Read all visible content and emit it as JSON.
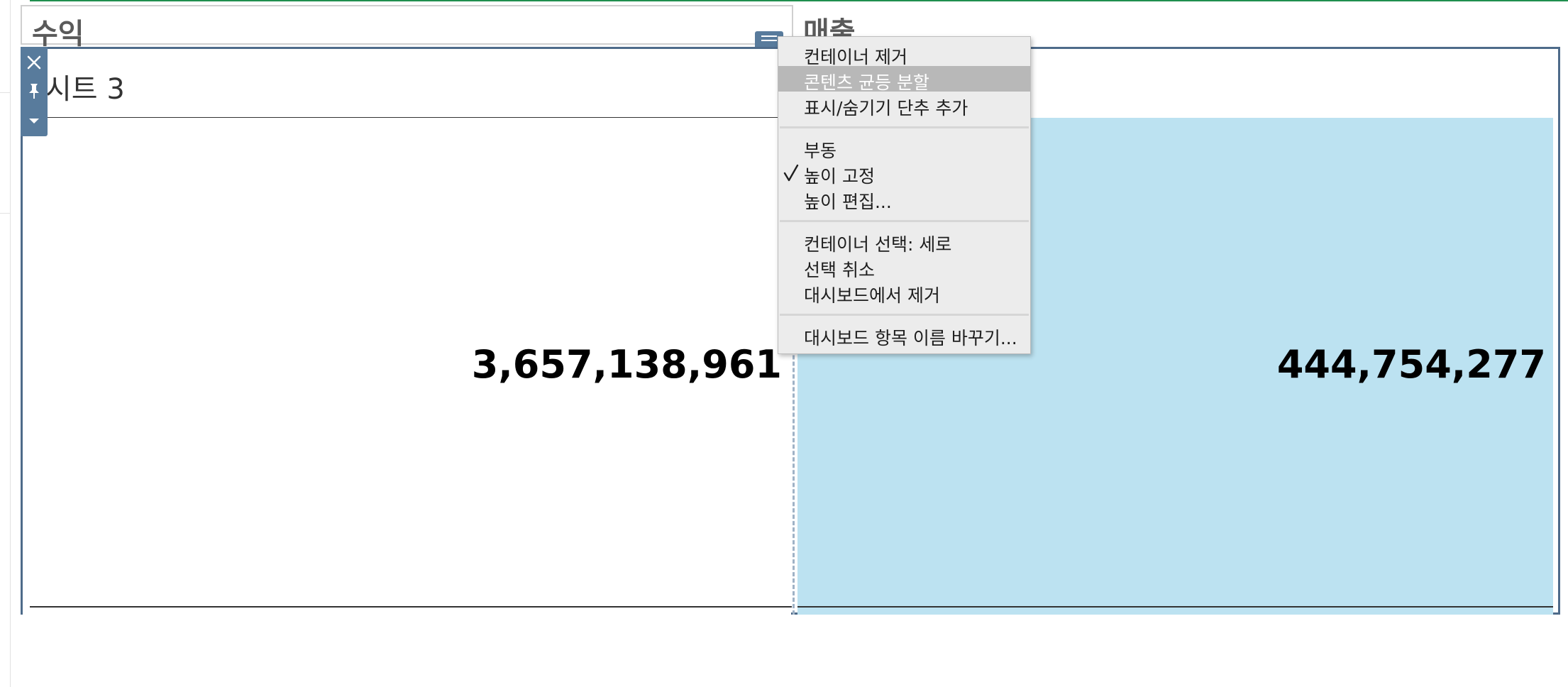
{
  "dashboard": {
    "title_profit": "수익",
    "title_sales": "매출",
    "sheet_title": "시트 3"
  },
  "values": {
    "profit": "3,657,138,961",
    "sales": "444,754,277"
  },
  "context_menu": {
    "groups": [
      [
        {
          "label": "컨테이너 제거",
          "highlighted": false
        },
        {
          "label": "콘텐츠 균등 분할",
          "highlighted": true
        },
        {
          "label": "표시/숨기기 단추 추가",
          "highlighted": false
        }
      ],
      [
        {
          "label": "부동",
          "checked": false
        },
        {
          "label": "높이 고정",
          "checked": true
        },
        {
          "label": "높이 편집...",
          "checked": false
        }
      ],
      [
        {
          "label": "컨테이너 선택: 세로"
        },
        {
          "label": "선택 취소"
        },
        {
          "label": "대시보드에서 제거"
        }
      ],
      [
        {
          "label": "대시보드 항목 이름 바꾸기..."
        }
      ]
    ]
  },
  "toolbar": {
    "icons": [
      "close-icon",
      "pin-icon",
      "dropdown-arrow-icon"
    ]
  },
  "colors": {
    "accent_frame": "#4e6b8a",
    "toolbar": "#587b9c",
    "sales_fill": "#bce2f1",
    "menu_highlight": "#b8b8b8",
    "top_line": "#1f8f4e"
  }
}
